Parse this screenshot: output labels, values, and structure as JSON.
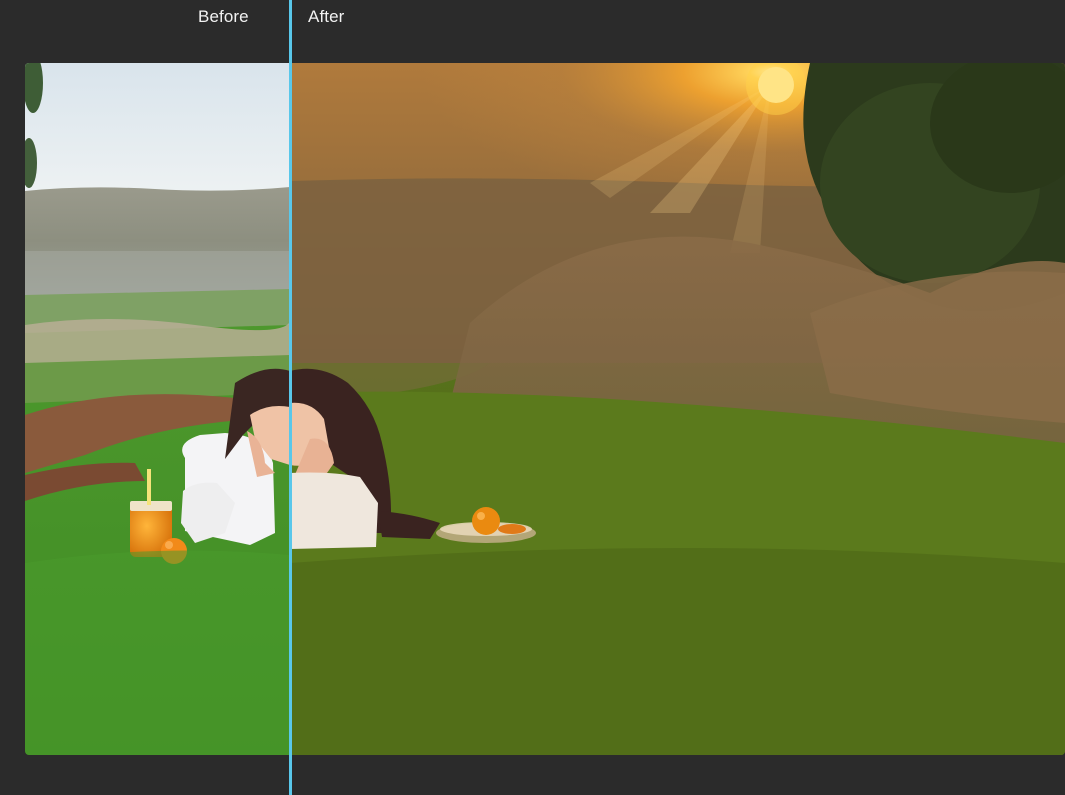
{
  "compare": {
    "before_label": "Before",
    "after_label": "After",
    "split_fraction": 0.255
  },
  "colors": {
    "background": "#2b2b2b",
    "divider": "#59c7ea",
    "label_text": "#f2f2f2"
  },
  "icons": [
    "split-divider-handle"
  ]
}
